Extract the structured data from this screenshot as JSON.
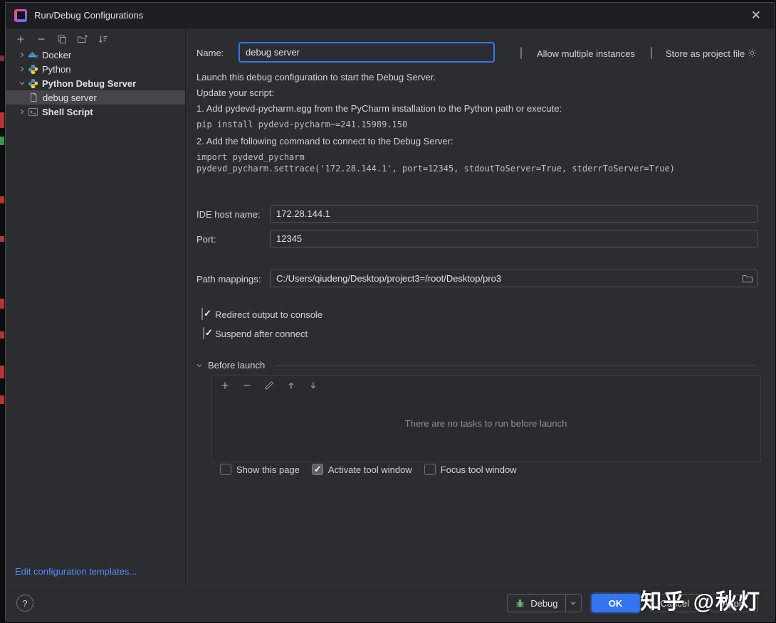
{
  "window": {
    "title": "Run/Debug Configurations",
    "close_glyph": "✕"
  },
  "sidebar": {
    "tree": [
      {
        "label": "Docker"
      },
      {
        "label": "Python"
      },
      {
        "label": "Python Debug Server"
      },
      {
        "label": "debug server"
      },
      {
        "label": "Shell Script"
      }
    ],
    "edit_templates_link": "Edit configuration templates..."
  },
  "form": {
    "name_label": "Name:",
    "name_value": "debug server",
    "allow_multiple_label": "Allow multiple instances",
    "store_project_label": "Store as project file",
    "description_line1": "Launch this debug configuration to start the Debug Server.",
    "description_line2": "Update your script:",
    "step1": "1. Add pydevd-pycharm.egg from the PyCharm installation to the Python path or execute:",
    "step1_code": "pip install pydevd-pycharm~=241.15989.150",
    "step2": "2. Add the following command to connect to the Debug Server:",
    "step2_code_line1": "import pydevd_pycharm",
    "step2_code_line2": "pydevd_pycharm.settrace('172.28.144.1', port=12345, stdoutToServer=True, stderrToServer=True)",
    "ide_host_label": "IDE host name:",
    "ide_host_value": "172.28.144.1",
    "port_label": "Port:",
    "port_value": "12345",
    "path_mappings_label": "Path mappings:",
    "path_mappings_value": "C:/Users/qiudeng/Desktop/project3=/root/Desktop/pro3",
    "redirect_output_label": "Redirect output to console",
    "suspend_label": "Suspend after connect"
  },
  "before_launch": {
    "title": "Before launch",
    "empty_text": "There are no tasks to run before launch",
    "show_this_page_label": "Show this page",
    "activate_tool_window_label": "Activate tool window",
    "focus_tool_window_label": "Focus tool window"
  },
  "states": {
    "allow_multiple": false,
    "store_as_project": false,
    "redirect_output": true,
    "suspend_after_connect": true,
    "show_this_page": false,
    "activate_tool_window": true,
    "focus_tool_window": false
  },
  "footer": {
    "help_label": "?",
    "debug_label": "Debug",
    "ok_label": "OK",
    "cancel_label": "Cancel",
    "apply_label": "Apply"
  },
  "watermark": "知乎 @秋灯",
  "colors": {
    "accent": "#3574f0",
    "link": "#548af7",
    "selection": "#43454a",
    "background": "#2b2d30",
    "titlebar": "#1e1f22"
  }
}
